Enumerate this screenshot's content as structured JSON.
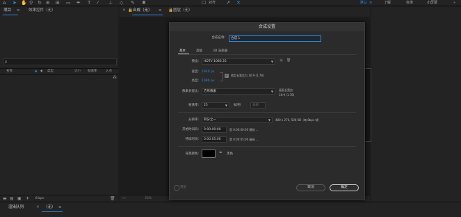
{
  "workspaces": [
    "默认",
    "了解",
    "标准",
    "小屏幕"
  ],
  "toolbar": {
    "snap_label": "对齐"
  },
  "project_panel": {
    "tab_project": "项目",
    "tab_effects": "效果控件（无）",
    "search_placeholder": "ρ",
    "columns": [
      "名称",
      "类型",
      "大小",
      "帧速率",
      "入点"
    ],
    "bpc": "8 bpc"
  },
  "comp_viewer": {
    "tab_label": "合成（无）",
    "layer_tab": "图层（无）",
    "zoom": "33%"
  },
  "bottom_panel": {
    "render_queue": "渲染队列",
    "comp_none": "（无）"
  },
  "dialog": {
    "title": "合成设置",
    "name_label": "合成名称:",
    "name_value": "合成 1",
    "tabs": [
      "基本",
      "高级",
      "3D 渲染器"
    ],
    "preset_label": "预设:",
    "preset_value": "HDTV 1080 25",
    "width_label": "宽度:",
    "width_value": "1920 px",
    "height_label": "高度:",
    "height_value": "1080 px",
    "lock_aspect_label": "锁定长宽比为 16:9 (1.78)",
    "lock_aspect_checked": true,
    "par_label": "像素长宽比:",
    "par_value": "方形像素",
    "frame_aspect_label": "画面长宽比:",
    "frame_aspect_value": "16:9 (1.78)",
    "fps_label": "帧速率:",
    "fps_value": "25",
    "fps_unit": "帧/秒",
    "drop_frame": "丢帧",
    "resolution_label": "分辨率:",
    "resolution_value": "四分之一",
    "resolution_info": "480 x 270, 506 KB（每 8bpc 帧）",
    "start_tc_label": "开始时间码:",
    "start_tc_value": "0:00:00:00",
    "start_tc_info": "是 0:00:00:00 基础 ...",
    "duration_label": "持续时间:",
    "duration_value": "0:00:05:00",
    "duration_info": "是 0:00:05:00 基础 ...",
    "bg_color_label": "背景颜色:",
    "bg_color_name": "黑色",
    "bg_color_hex": "#000000",
    "preview_label": "预览",
    "cancel_label": "取消",
    "ok_label": "确定"
  }
}
